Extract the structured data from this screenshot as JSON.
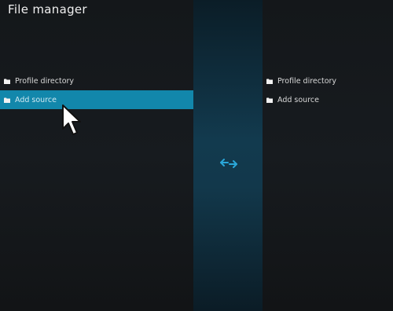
{
  "window": {
    "title": "File manager"
  },
  "left_pane": {
    "items": [
      {
        "label": "Profile directory",
        "icon": "folder-icon",
        "selected": false
      },
      {
        "label": "Add source",
        "icon": "folder-icon",
        "selected": true
      }
    ]
  },
  "right_pane": {
    "items": [
      {
        "label": "Profile directory",
        "icon": "folder-icon",
        "selected": false
      },
      {
        "label": "Add source",
        "icon": "folder-icon",
        "selected": false
      }
    ]
  },
  "center": {
    "icon": "swap-arrows-icon"
  },
  "colors": {
    "selection": "#1287ab",
    "accent_icon": "#2aa7d8",
    "background": "#15181b",
    "divider": "#123a4e"
  }
}
